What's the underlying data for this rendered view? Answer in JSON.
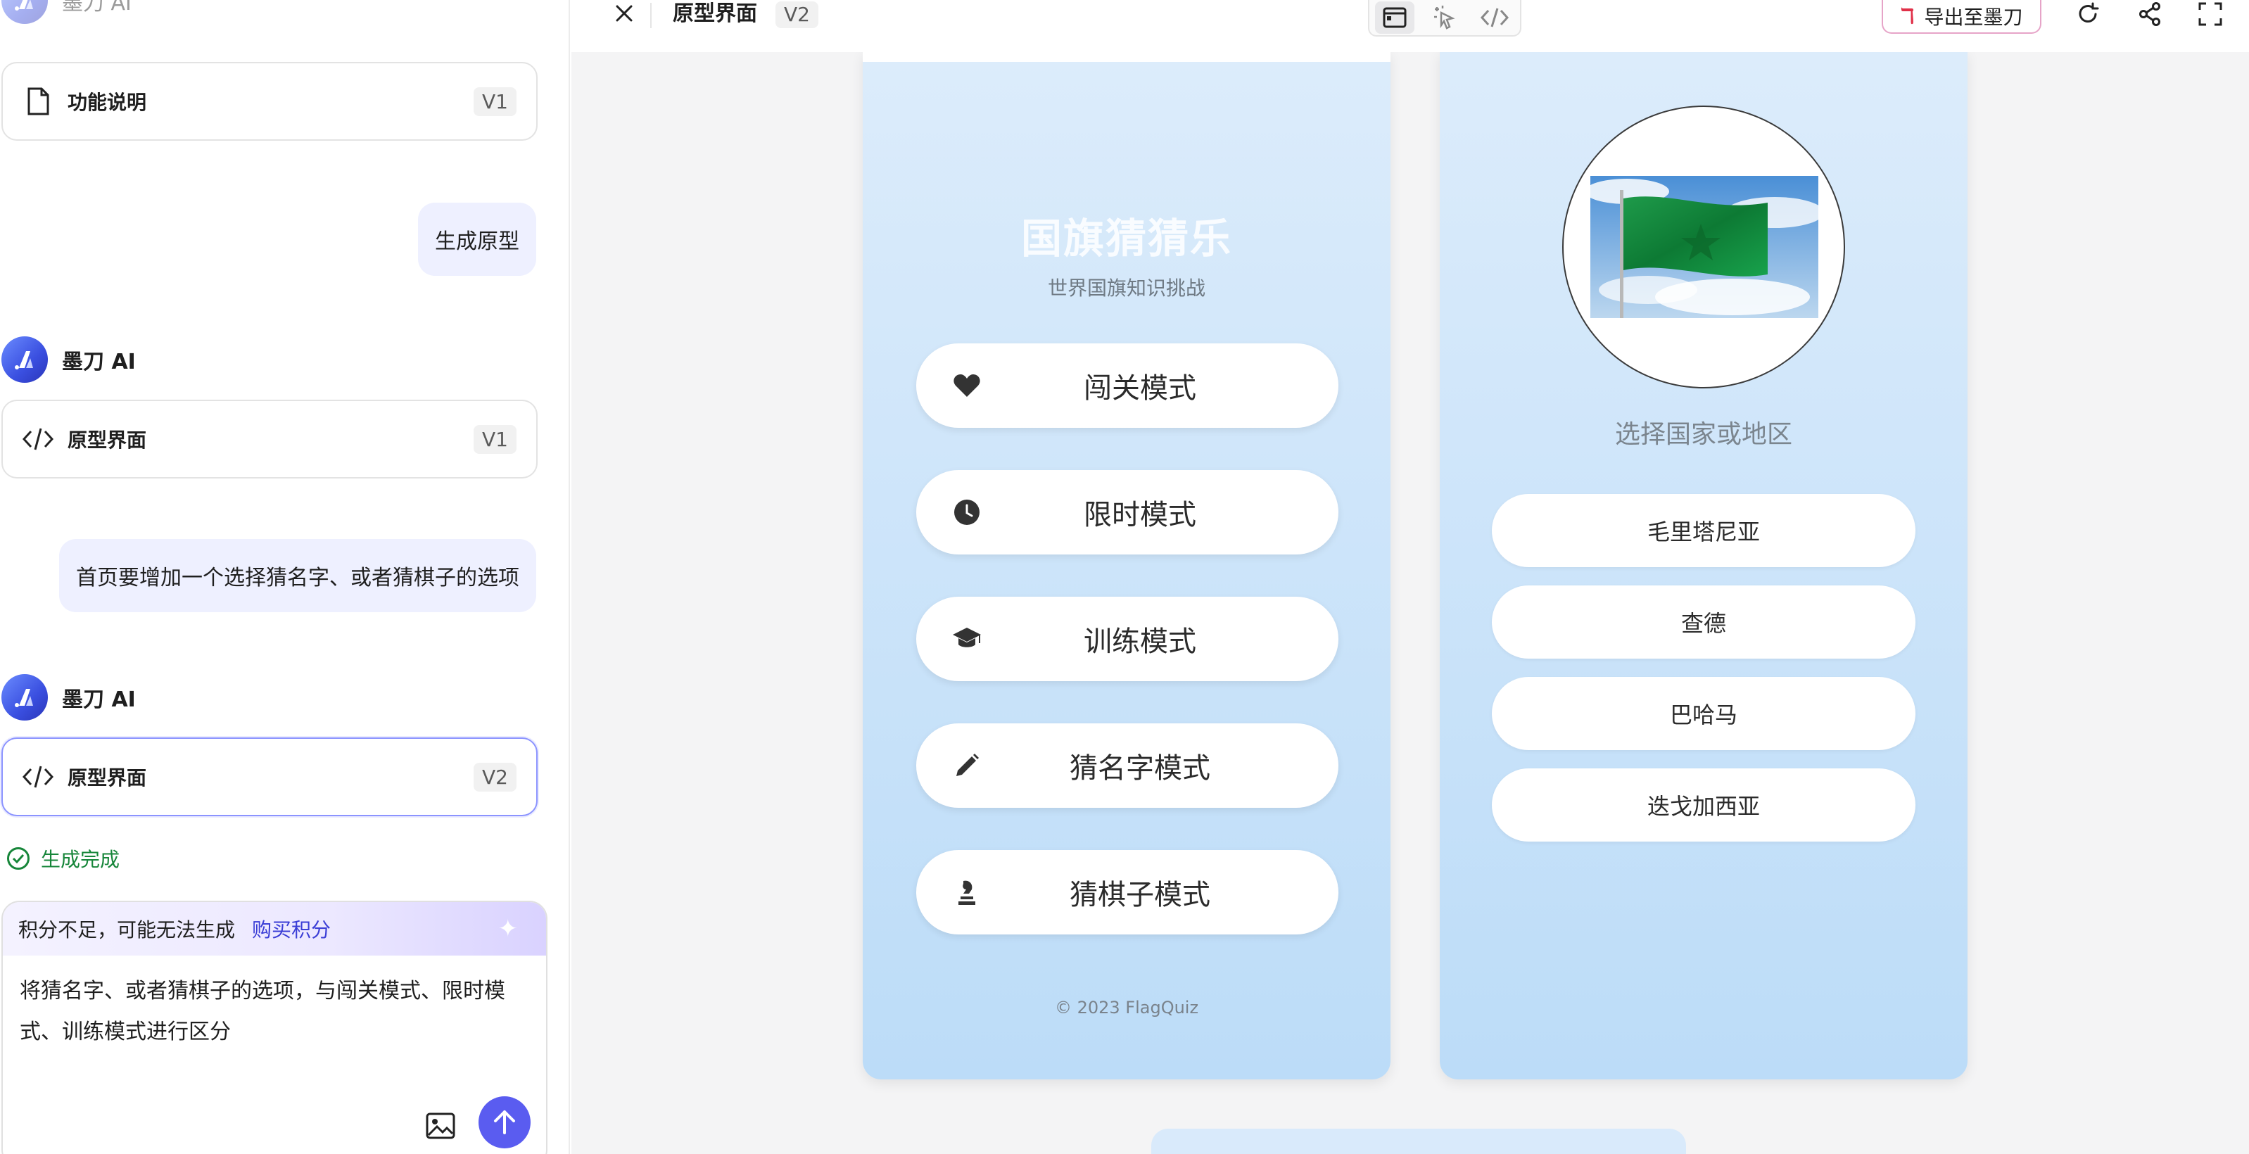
{
  "chat": {
    "ai_name": "墨刀 AI",
    "ai_name_top": "墨刀 AI",
    "files": [
      {
        "name": "功能说明",
        "version": "V1"
      },
      {
        "name": "原型界面",
        "version": "V1"
      },
      {
        "name": "原型界面",
        "version": "V2"
      }
    ],
    "user_messages": [
      "生成原型",
      "首页要增加一个选择猜名字、或者猜棋子的选项"
    ],
    "status": "生成完成",
    "credit_notice": "积分不足，可能无法生成",
    "buy_credits": "购买积分",
    "input_value": "将猜名字、或者猜棋子的选项，与闯关模式、限时模式、训练模式进行区分"
  },
  "toolbar": {
    "title": "原型界面",
    "version": "V2",
    "export_label": "导出至墨刀",
    "export_logo": "ℸ"
  },
  "phone1": {
    "title": "国旗猜猜乐",
    "subtitle": "世界国旗知识挑战",
    "modes": [
      {
        "label": "闯关模式",
        "icon": "heart-icon"
      },
      {
        "label": "限时模式",
        "icon": "clock-icon"
      },
      {
        "label": "训练模式",
        "icon": "graduation-cap-icon"
      },
      {
        "label": "猜名字模式",
        "icon": "pencil-icon"
      },
      {
        "label": "猜棋子模式",
        "icon": "chess-piece-icon"
      }
    ],
    "footer": "© 2023 FlagQuiz"
  },
  "phone2": {
    "prompt": "选择国家或地区",
    "options": [
      "毛里塔尼亚",
      "查德",
      "巴哈马",
      "迭戈加西亚"
    ]
  },
  "colors": {
    "accent": "#5a5cf0",
    "status_green": "#17863a",
    "phone_top": "#dcecfb",
    "phone_bottom": "#bcdcf8"
  }
}
